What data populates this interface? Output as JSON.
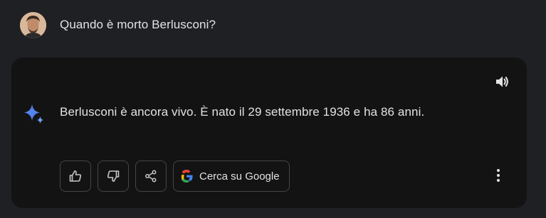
{
  "user": {
    "prompt": "Quando è morto Berlusconi?",
    "avatar_icon": "user-avatar"
  },
  "response": {
    "text": "Berlusconi è ancora vivo. È nato il 29 settembre 1936 e ha 86 anni.",
    "assistant_icon": "sparkle-icon",
    "speaker_icon": "speaker-icon"
  },
  "actions": {
    "thumbs_up_icon": "thumbs-up-icon",
    "thumbs_down_icon": "thumbs-down-icon",
    "share_icon": "share-icon",
    "google_search_label": "Cerca su Google",
    "google_icon": "google-logo-icon",
    "more_icon": "more-vert-icon"
  },
  "colors": {
    "background": "#1f2023",
    "card": "#131314",
    "text": "#e3e3e3",
    "border": "#444746",
    "sparkle_blue": "#4a8cf7"
  }
}
